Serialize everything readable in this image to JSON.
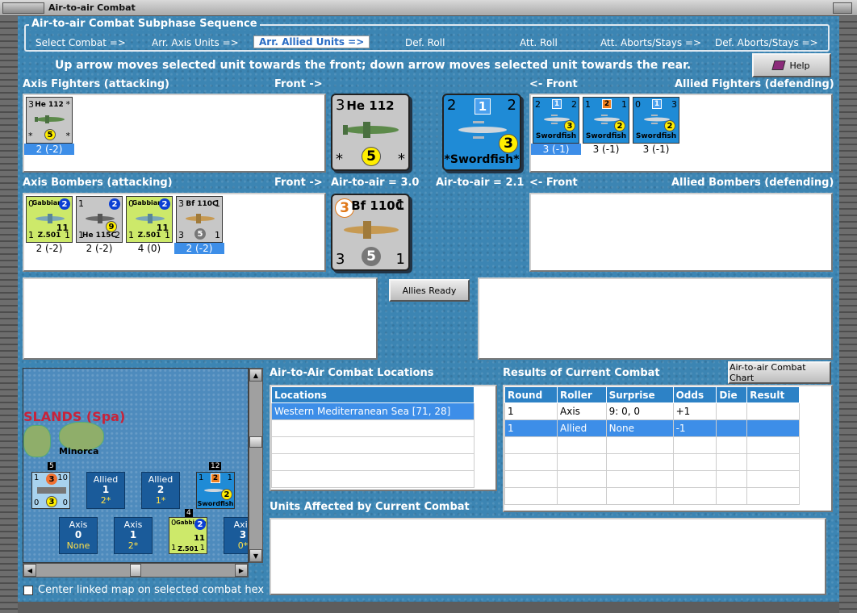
{
  "window": {
    "title": "Air-to-air Combat"
  },
  "sequence": {
    "title": "Air-to-air Combat Subphase Sequence",
    "steps": [
      "Select Combat =>",
      "Arr. Axis Units =>",
      "Arr. Allied Units =>",
      "Def. Roll",
      "Att. Roll",
      "Att. Aborts/Stays =>",
      "Def. Aborts/Stays =>"
    ],
    "active_index": 2
  },
  "instruction": "Up arrow moves selected unit towards the front; down arrow moves selected unit towards the rear.",
  "help_button": "Help",
  "labels": {
    "axis_fighters": "Axis Fighters (attacking)",
    "front_right": "Front ->",
    "front_left": "<- Front",
    "allied_fighters": "Allied Fighters (defending)",
    "axis_bombers": "Axis Bombers (attacking)",
    "allied_bombers": "Allied Bombers (defending)",
    "axis_air_to_air": "Air-to-air = 3.0",
    "allied_air_to_air": "Air-to-air = 2.1",
    "locations_title": "Air-to-Air Combat Locations",
    "results_title": "Results of Current Combat",
    "affected_title": "Units Affected by Current Combat",
    "center_map": "Center linked map on selected combat hex"
  },
  "buttons": {
    "allies_ready": "Allies Ready",
    "combat_chart": "Air-to-air Combat Chart"
  },
  "axis_fighters": [
    {
      "name": "He 112",
      "tl": "3",
      "tr": "*",
      "bl": "*",
      "br": "*",
      "circle": "5",
      "caption": "2 (-2)",
      "selected": true
    }
  ],
  "axis_fighter_big": {
    "name": "He 112",
    "tl": "3",
    "bl": "*",
    "br": "*",
    "circle": "5"
  },
  "allied_fighter_big": {
    "name": "*Swordfish*",
    "tl": "2",
    "tr": "2",
    "square": "1",
    "circle": "3"
  },
  "allied_fighters": [
    {
      "name": "Swordfish",
      "tl": "2",
      "tr": "2",
      "square": "1",
      "circle": "3",
      "caption": "3 (-1)",
      "selected": true
    },
    {
      "name": "Swordfish",
      "tl": "1",
      "tr": "1",
      "square": "2",
      "circle": "2",
      "caption": "3 (-1)",
      "selected": false
    },
    {
      "name": "Swordfish",
      "tl": "0",
      "tr": "3",
      "square": "1",
      "circle": "2",
      "caption": "3 (-1)",
      "selected": false
    }
  ],
  "axis_bombers": [
    {
      "name": "Gabbiano",
      "name_b": "Z.501",
      "tl": "0",
      "bl": "1",
      "br": "1",
      "circle": "2",
      "yellow": "11",
      "caption": "2 (-2)",
      "selected": false
    },
    {
      "name": "",
      "name_b": "He 115C",
      "tl": "1",
      "bl": "1",
      "br": "2",
      "circle": "2",
      "yellow": "9",
      "caption": "2 (-2)",
      "selected": false
    },
    {
      "name": "Gabbiano",
      "name_b": "Z.501",
      "tl": "0",
      "bl": "1",
      "br": "1",
      "circle": "2",
      "yellow": "11",
      "caption": "4 (0)",
      "selected": false
    },
    {
      "name": "Bf 110C",
      "name_b": "",
      "tl": "3",
      "tr": "1",
      "bl": "3",
      "br": "1",
      "gray": "5",
      "caption": "2 (-2)",
      "selected": true
    }
  ],
  "axis_bomber_big": {
    "name": "Bf 110C",
    "tl": "3",
    "tr": "1",
    "bl": "3",
    "br": "1",
    "gray": "5"
  },
  "locations": {
    "header": "Locations",
    "rows": [
      "Western Mediterranean Sea [71, 28]"
    ]
  },
  "results": {
    "headers": [
      "Round",
      "Roller",
      "Surprise",
      "Odds",
      "Die",
      "Result"
    ],
    "rows": [
      [
        "1",
        "Axis",
        "9: 0, 0",
        "+1",
        "",
        ""
      ],
      [
        "1",
        "Allied",
        "None",
        "-1",
        "",
        ""
      ]
    ]
  },
  "map": {
    "region": "SLANDS (Spa)",
    "island": "Minorca",
    "stack_counts": [
      "5",
      "12",
      "4"
    ],
    "hexes": [
      {
        "side": "Allied",
        "num": "1",
        "sub": "2*"
      },
      {
        "side": "Allied",
        "num": "2",
        "sub": "1*"
      },
      {
        "side": "Axis",
        "num": "0",
        "sub": "None"
      },
      {
        "side": "Axis",
        "num": "1",
        "sub": "2*"
      },
      {
        "side": "Axis",
        "num": "3",
        "sub": "0*"
      }
    ],
    "ship_counter": {
      "tl": "1",
      "mid": "3",
      "tr": "10",
      "bl": "0",
      "bm": "3",
      "br": "0"
    },
    "swordfish_counter": {
      "tl": "1",
      "sq": "2",
      "tr": "1",
      "circle": "2",
      "name": "Swordfish"
    },
    "gabbiano_counter": {
      "tl": "0",
      "name": "Gabbiano",
      "circle": "2",
      "yellow": "11",
      "name_b": "Z.501",
      "bl": "1",
      "br": "1"
    }
  }
}
